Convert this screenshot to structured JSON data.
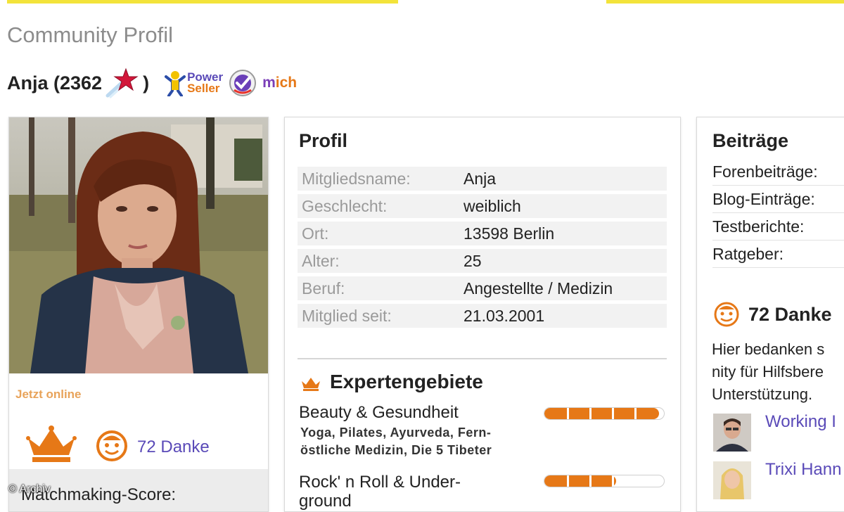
{
  "header": {
    "page_title": "Community Profil",
    "username": "Anja (2362",
    "close_paren": ")",
    "power_label": "Power",
    "seller_label": "Seller",
    "mich_prefix": "m",
    "mich_suffix": "ich"
  },
  "left_card": {
    "online_status": "Jetzt online",
    "danke_link": "72 Danke",
    "matchmaking_label": "Matchmaking-Score:",
    "copyright": "© Archiv"
  },
  "profil": {
    "title": "Profil",
    "rows": [
      {
        "label": "Mitgliedsname:",
        "value": "Anja"
      },
      {
        "label": "Geschlecht:",
        "value": "weiblich"
      },
      {
        "label": "Ort:",
        "value": "13598 Berlin"
      },
      {
        "label": "Alter:",
        "value": "25"
      },
      {
        "label": "Beruf:",
        "value": "Angestellte / Medizin"
      },
      {
        "label": "Mitglied seit:",
        "value": "21.03.2001"
      }
    ],
    "expert_title": "Expertengebiete",
    "experts": [
      {
        "name": "Beauty & Gesundheit",
        "desc_line1": "Yoga, Pilates, Ayurveda, Fern-",
        "desc_line2": "östliche Medizin, Die 5 Tibeter",
        "level_fraction": 0.96
      },
      {
        "name_line1": "Rock' n Roll & Under-",
        "name_line2": "ground",
        "level_fraction": 0.6
      }
    ]
  },
  "beitraege": {
    "title": "Beiträge",
    "rows": [
      "Forenbeiträge:",
      "Blog-Einträge:",
      "Testberichte:",
      "Ratgeber:"
    ],
    "danke_heading": "72 Danke",
    "danke_text_1": "Hier bedanken s",
    "danke_text_2": "nity für Hilfsbere",
    "danke_text_3": "Unterstützung.",
    "thankers": [
      "Working I",
      "Trixi Hann"
    ]
  },
  "colors": {
    "accent_orange": "#e67817",
    "link_purple": "#5a4ab8",
    "topbar_yellow": "#f3e33a"
  }
}
